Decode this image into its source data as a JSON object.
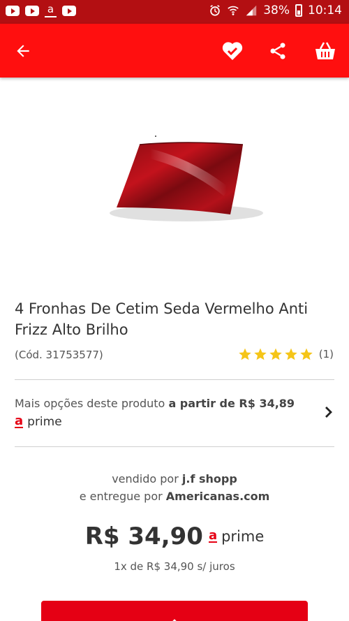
{
  "status_bar": {
    "battery": "38%",
    "time": "10:14",
    "notif_a": "a"
  },
  "colors": {
    "status_bar": "#b30f12",
    "app_bar": "#ff0f0f",
    "brand_red": "#e60014",
    "star": "#f5c518"
  },
  "app_bar": {
    "icons": [
      "back-arrow-icon",
      "favorite-heart-check-icon",
      "share-icon",
      "shopping-basket-icon"
    ]
  },
  "product": {
    "title": "4 Fronhas De Cetim Seda Vermelho Anti Frizz Alto Brilho",
    "code": "(Cód. 31753577)",
    "rating_stars": 5,
    "rating_count": "(1)"
  },
  "more_options": {
    "prefix": "Mais opções deste produto",
    "price_text": "a partir de R$ 34,89",
    "prime_logo": "a",
    "prime_label": "prime"
  },
  "seller": {
    "sold_by_prefix": "vendido por",
    "sold_by": "j.f shopp",
    "delivered_prefix": "e entregue por",
    "delivered_by": "Americanas.com"
  },
  "pricing": {
    "price": "R$ 34,90",
    "prime_logo": "a",
    "prime_label": "prime",
    "installments": "1x de R$ 34,90 s/ juros"
  }
}
